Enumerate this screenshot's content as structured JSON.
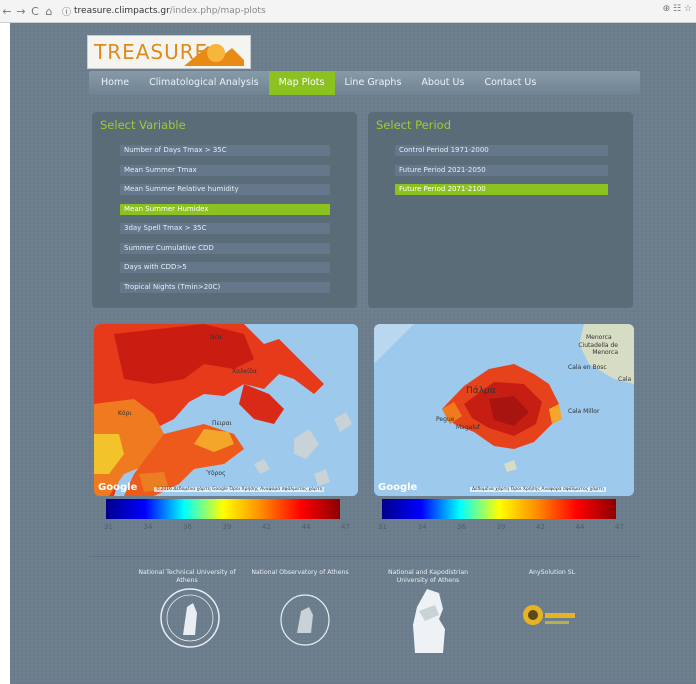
{
  "browser": {
    "url_host": "treasure.climpacts.gr",
    "url_path": "/index.php/map-plots"
  },
  "logo": {
    "text": "TREASURE"
  },
  "nav": {
    "items": [
      "Home",
      "Climatological Analysis",
      "Map Plots",
      "Line Graphs",
      "About Us",
      "Contact Us"
    ],
    "active": "Map Plots"
  },
  "variables": {
    "title": "Select Variable",
    "options": [
      "Number of Days Tmax > 35C",
      "Mean Summer Tmax",
      "Mean Summer Relative humidity",
      "Mean Summer Humidex",
      "3day Spell Tmax > 35C",
      "Summer Cumulative CDD",
      "Days with CDD>5",
      "Tropical Nights (Tmin>20C)"
    ],
    "selected": "Mean Summer Humidex"
  },
  "periods": {
    "title": "Select Period",
    "options": [
      "Control Period 1971-2000",
      "Future Period 2021-2050",
      "Future Period 2071-2100"
    ],
    "selected": "Future Period 2071-2100"
  },
  "maps": {
    "left": {
      "google": "Google",
      "attribution": "©2016 Δεδομένα χάρτη Google   Όροι Χρήσης   Αναφορά σφάλματος χάρτη",
      "labels": [
        "Νέα",
        "Χαλκίδα",
        "Κόρι",
        "Πειραι",
        "Ύδρος"
      ]
    },
    "right": {
      "google": "Google",
      "attribution": "Δεδομένα χάρτη   Όροι Χρήσης   Αναφορά σφάλματος χάρτη",
      "labels": [
        "Menorca",
        "Ciutadella de Menorca",
        "Cala en Bosc",
        "Cala",
        "Πάλμα",
        "Cala Millor",
        "Pegue",
        "Magaluf"
      ]
    }
  },
  "colorbar": {
    "ticks": [
      "31",
      "34",
      "36",
      "39",
      "42",
      "44",
      "47"
    ],
    "colors": [
      "#00008b",
      "#0000ff",
      "#00ffff",
      "#ffff00",
      "#ff8800",
      "#ff0000",
      "#8b0000"
    ]
  },
  "footer": {
    "institutions": [
      "National Technical University of Athens",
      "National Observatory of Athens",
      "National and Kapodistrian University of Athens",
      "AnySolution SL"
    ]
  }
}
